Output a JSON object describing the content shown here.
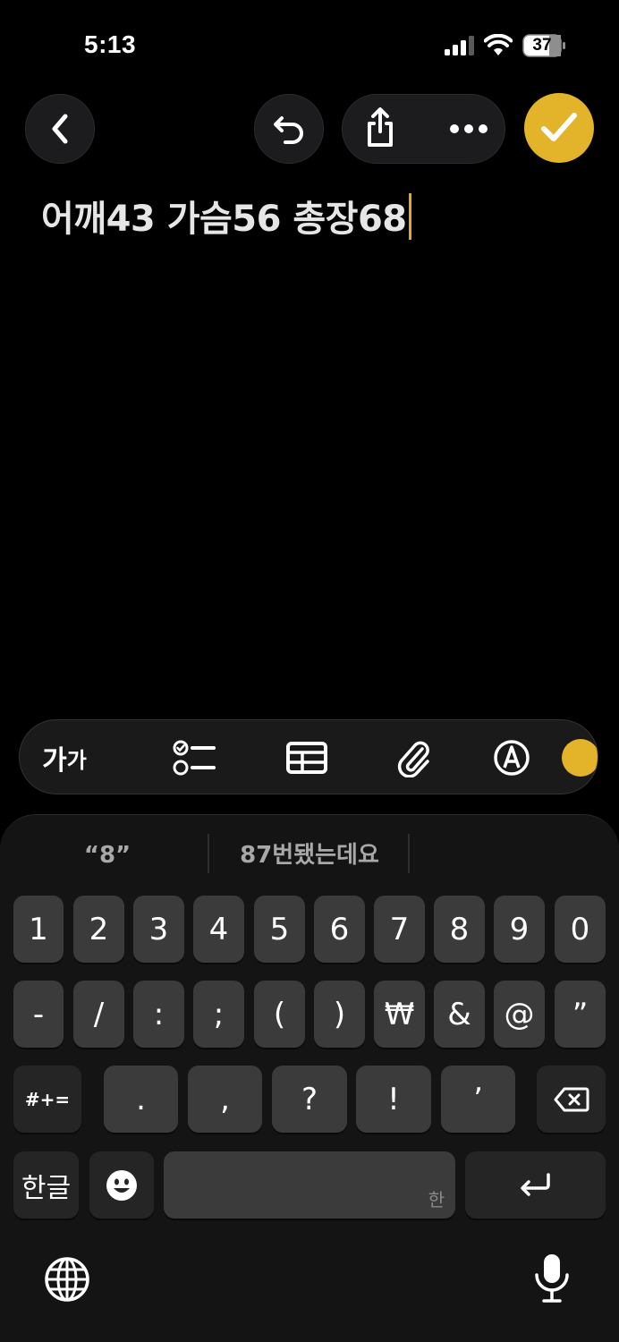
{
  "status_bar": {
    "time": "5:13",
    "battery": "37",
    "signal_icon": "cellular-signal-icon",
    "wifi_icon": "wifi-icon",
    "battery_icon": "battery-icon"
  },
  "nav": {
    "back_icon": "chevron-left-icon",
    "undo_icon": "undo-icon",
    "share_icon": "share-icon",
    "more_icon": "ellipsis-icon",
    "done_icon": "checkmark-icon",
    "accent_color": "#e3b32a"
  },
  "note": {
    "text": "어깨43 가슴56 총장68"
  },
  "format_toolbar": {
    "text_style_big": "가",
    "text_style_small": "가",
    "items": [
      "text-style-icon",
      "checklist-icon",
      "table-icon",
      "paperclip-icon",
      "markup-icon",
      "writing-tools-icon"
    ]
  },
  "keyboard": {
    "suggestions": [
      "“8”",
      "87번됐는데요"
    ],
    "row1": [
      "1",
      "2",
      "3",
      "4",
      "5",
      "6",
      "7",
      "8",
      "9",
      "0"
    ],
    "row2": [
      "-",
      "/",
      ":",
      ";",
      "(",
      ")",
      "₩",
      "&",
      "@",
      "”"
    ],
    "row3_shift": "#+=",
    "row3": [
      ".",
      ",",
      "?",
      "!",
      "’"
    ],
    "row4": {
      "lang_key": "한글",
      "space_hint": "한"
    },
    "icons": [
      "delete-icon",
      "emoji-icon",
      "return-icon",
      "globe-icon",
      "microphone-icon"
    ]
  }
}
